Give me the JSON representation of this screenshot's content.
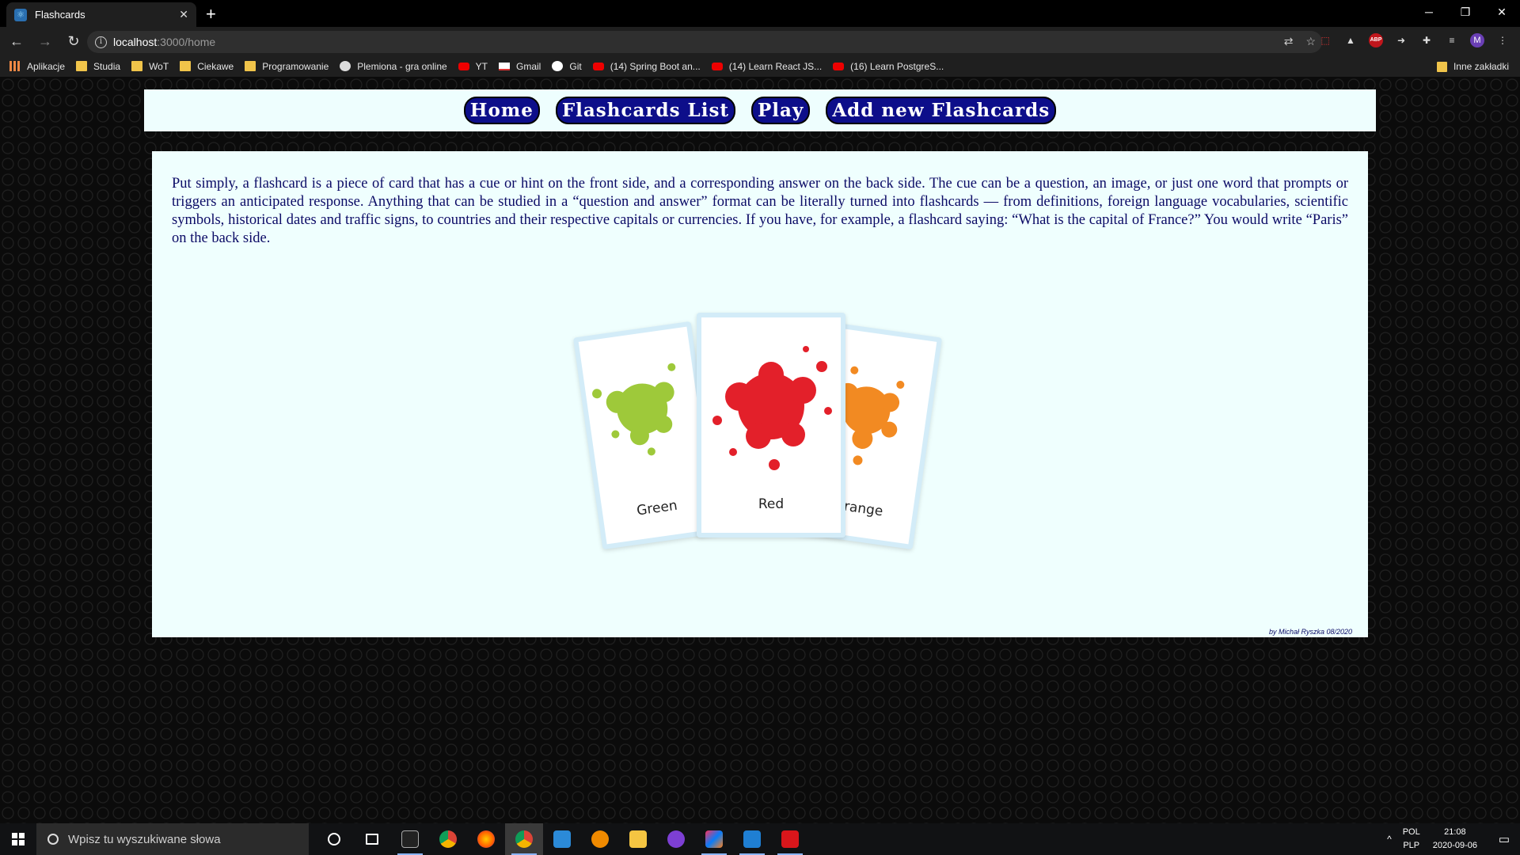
{
  "browser": {
    "tab_title": "Flashcards",
    "tab_close": "✕",
    "new_tab": "+",
    "window_buttons": [
      "─",
      "❐",
      "✕"
    ],
    "url_host": "localhost",
    "url_path": ":3000/home"
  },
  "bookmarks": {
    "items": [
      {
        "label": "Aplikacje",
        "icon": "apps-icon"
      },
      {
        "label": "Studia",
        "icon": "folder-icon"
      },
      {
        "label": "WoT",
        "icon": "folder-icon"
      },
      {
        "label": "Ciekawe",
        "icon": "folder-icon"
      },
      {
        "label": "Programowanie",
        "icon": "folder-icon"
      },
      {
        "label": "Plemiona - gra online",
        "icon": "plemiona-icon"
      },
      {
        "label": "YT",
        "icon": "youtube-icon"
      },
      {
        "label": "Gmail",
        "icon": "gmail-icon"
      },
      {
        "label": "Git",
        "icon": "github-icon"
      },
      {
        "label": "(14) Spring Boot an...",
        "icon": "youtube-icon"
      },
      {
        "label": "(14) Learn React JS...",
        "icon": "youtube-icon"
      },
      {
        "label": "(16) Learn PostgreS...",
        "icon": "youtube-icon"
      }
    ],
    "other": "Inne zakładki"
  },
  "nav": {
    "home": "Home",
    "list": "Flashcards List",
    "play": "Play",
    "add": "Add new Flashcards"
  },
  "main": {
    "intro": "Put simply, a flashcard is a piece of card that has a cue or hint on the front side, and a corresponding answer on the back side. The cue can be a question, an image, or just one word that prompts or triggers an anticipated response. Anything that can be studied in a “question and answer” format can be literally turned into flashcards — from definitions, foreign language vocabularies, scientific symbols, historical dates and traffic signs, to countries and their respective capitals or currencies. If you have, for example, a flashcard saying: “What is the capital of France?” You would write “Paris” on the back side.",
    "cards": [
      {
        "label": "Green",
        "color": "#9ec93a"
      },
      {
        "label": "Red",
        "color": "#e3202a"
      },
      {
        "label": "Orange",
        "color": "#f28a22"
      }
    ],
    "credit": "by Michał Ryszka 08/2020"
  },
  "taskbar": {
    "search_placeholder": "Wpisz tu wyszukiwane słowa",
    "lang_top": "POL",
    "lang_bottom": "PLP",
    "time": "21:08",
    "date": "2020-09-06"
  }
}
